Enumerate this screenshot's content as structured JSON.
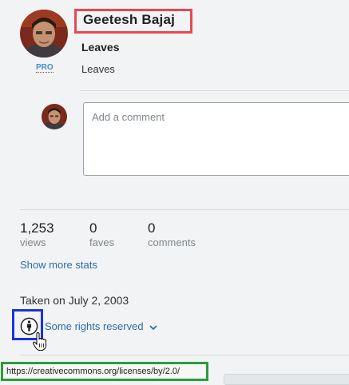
{
  "author": {
    "name": "Geetesh Bajaj",
    "badge": "PRO"
  },
  "photo": {
    "title": "Leaves",
    "description": "Leaves"
  },
  "comment": {
    "placeholder": "Add a comment"
  },
  "stats": [
    {
      "value": "1,253",
      "label": "views"
    },
    {
      "value": "0",
      "label": "faves"
    },
    {
      "value": "0",
      "label": "comments"
    }
  ],
  "show_more_stats": "Show more stats",
  "taken_on": "Taken on July 2, 2003",
  "license": {
    "label": "Some rights reserved",
    "icon": "cc-by-person-icon"
  },
  "status_bar": {
    "url": "https://creativecommons.org/licenses/by/2.0/"
  },
  "colors": {
    "author_highlight": "#e8484f",
    "license_highlight": "#1a35d6",
    "status_highlight": "#2a9d3b",
    "link": "#2d6ca8"
  }
}
